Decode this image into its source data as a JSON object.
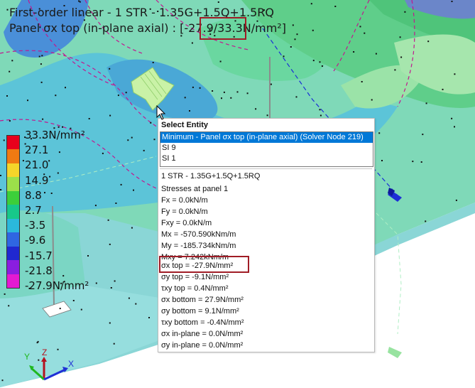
{
  "header": {
    "line1": "First-order linear - 1 STR - 1.35G+1.5Q+1.5RQ",
    "line2_prefix": "Panel σx top (in-plane axial) : ",
    "range_value": "[-27.9/33.3N/mm²]"
  },
  "legend": {
    "labels": [
      "33.3N/mm²",
      "27.1",
      "21.0",
      "14.9",
      "8.8",
      "2.7",
      "-3.5",
      "-9.6",
      "-15.7",
      "-21.8",
      "-27.9N/mm²"
    ],
    "colors": [
      "#e8001c",
      "#f07a12",
      "#f5d52a",
      "#9ce04a",
      "#3ccf3a",
      "#17c88a",
      "#2bb8dc",
      "#2f66e2",
      "#2028d0",
      "#8a1ee0",
      "#e41ad2"
    ]
  },
  "popup": {
    "title": "Select Entity",
    "entities": [
      "Minimum - Panel σx top (in-plane axial) (Solver Node 219)",
      "SI 9",
      "SI 1"
    ],
    "details": [
      "1 STR - 1.35G+1.5Q+1.5RQ",
      "Stresses at panel 1",
      "Fx = 0.0kN/m",
      "Fy = 0.0kN/m",
      "Fxy = 0.0kN/m",
      "Mx = -570.590kNm/m",
      "My = -185.734kNm/m",
      "Mxy = 7.242kNm/m",
      "σx top = -27.9N/mm²",
      "σy top = -9.1N/mm²",
      "τxy top = 0.4N/mm²",
      "σx bottom = 27.9N/mm²",
      "σy bottom = 9.1N/mm²",
      "τxy bottom = -0.4N/mm²",
      "σx in-plane = 0.0N/mm²",
      "σy in-plane = 0.0N/mm²"
    ]
  },
  "axes": {
    "x": "X",
    "y": "Y",
    "z": "Z"
  },
  "icons": [
    "pointer-cursor-icon",
    "support-arrow-icon",
    "axes-triad-icon"
  ],
  "colors": {
    "highlight": "#a01c26",
    "selection": "#0078d7"
  }
}
